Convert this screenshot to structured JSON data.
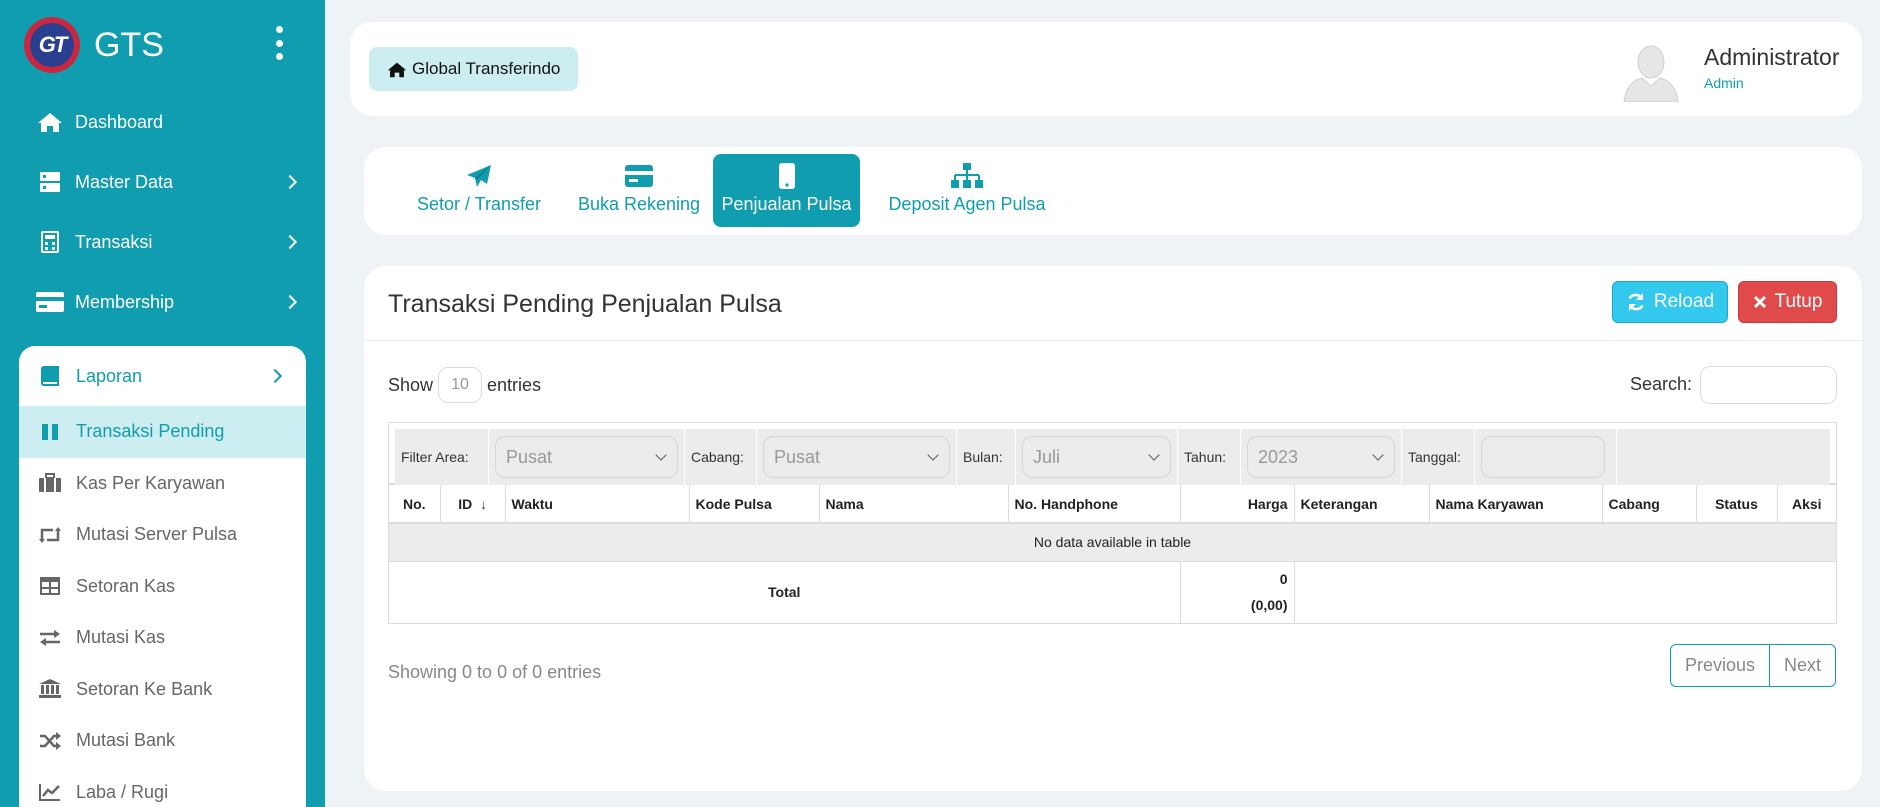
{
  "brand": {
    "logo_text": "GT",
    "name": "GTS"
  },
  "colors": {
    "primary": "#109daf",
    "active_sub_bg": "#cdeef1",
    "reload": "#33c8ee",
    "danger": "#e04a4a"
  },
  "sidebar": {
    "top_items": [
      {
        "label": "Dashboard",
        "icon": "home-icon"
      },
      {
        "label": "Master Data",
        "icon": "server-icon"
      },
      {
        "label": "Transaksi",
        "icon": "calculator-icon"
      },
      {
        "label": "Membership",
        "icon": "credit-card-icon"
      }
    ],
    "section": {
      "label": "Laporan",
      "icon": "book-icon"
    },
    "sub_items": [
      {
        "label": "Transaksi Pending",
        "icon": "pause-icon"
      },
      {
        "label": "Kas Per Karyawan",
        "icon": "briefcase-icon"
      },
      {
        "label": "Mutasi Server Pulsa",
        "icon": "retweet-icon"
      },
      {
        "label": "Setoran Kas",
        "icon": "table-icon"
      },
      {
        "label": "Mutasi Kas",
        "icon": "exchange-icon"
      },
      {
        "label": "Setoran Ke Bank",
        "icon": "bank-icon"
      },
      {
        "label": "Mutasi Bank",
        "icon": "shuffle-icon"
      },
      {
        "label": "Laba / Rugi",
        "icon": "line-chart-icon"
      }
    ]
  },
  "header": {
    "breadcrumb": "Global Transferindo",
    "user_name": "Administrator",
    "user_role": "Admin"
  },
  "tabs": [
    {
      "label": "Setor / Transfer",
      "icon": "paper-plane-icon"
    },
    {
      "label": "Buka Rekening",
      "icon": "credit-card-icon"
    },
    {
      "label": "Penjualan Pulsa",
      "icon": "mobile-icon"
    },
    {
      "label": "Deposit Agen Pulsa",
      "icon": "sitemap-icon"
    }
  ],
  "main": {
    "title": "Transaksi Pending Penjualan Pulsa",
    "reload_label": "Reload",
    "close_label": "Tutup",
    "show_label": "Show",
    "entries_label": "entries",
    "page_length": "10",
    "search_label": "Search:",
    "filters": {
      "area_label": "Filter Area:",
      "area_value": "Pusat",
      "cabang_label": "Cabang:",
      "cabang_value": "Pusat",
      "bulan_label": "Bulan:",
      "bulan_value": "Juli",
      "tahun_label": "Tahun:",
      "tahun_value": "2023",
      "tanggal_label": "Tanggal:"
    },
    "columns": [
      "No.",
      "ID",
      "Waktu",
      "Kode Pulsa",
      "Nama",
      "No. Handphone",
      "Harga",
      "Keterangan",
      "Nama Karyawan",
      "Cabang",
      "Status",
      "Aksi"
    ],
    "empty_text": "No data available in table",
    "total_label": "Total",
    "total_value": "0",
    "total_sub": "(0,00)",
    "info": "Showing 0 to 0 of 0 entries",
    "prev_label": "Previous",
    "next_label": "Next"
  }
}
